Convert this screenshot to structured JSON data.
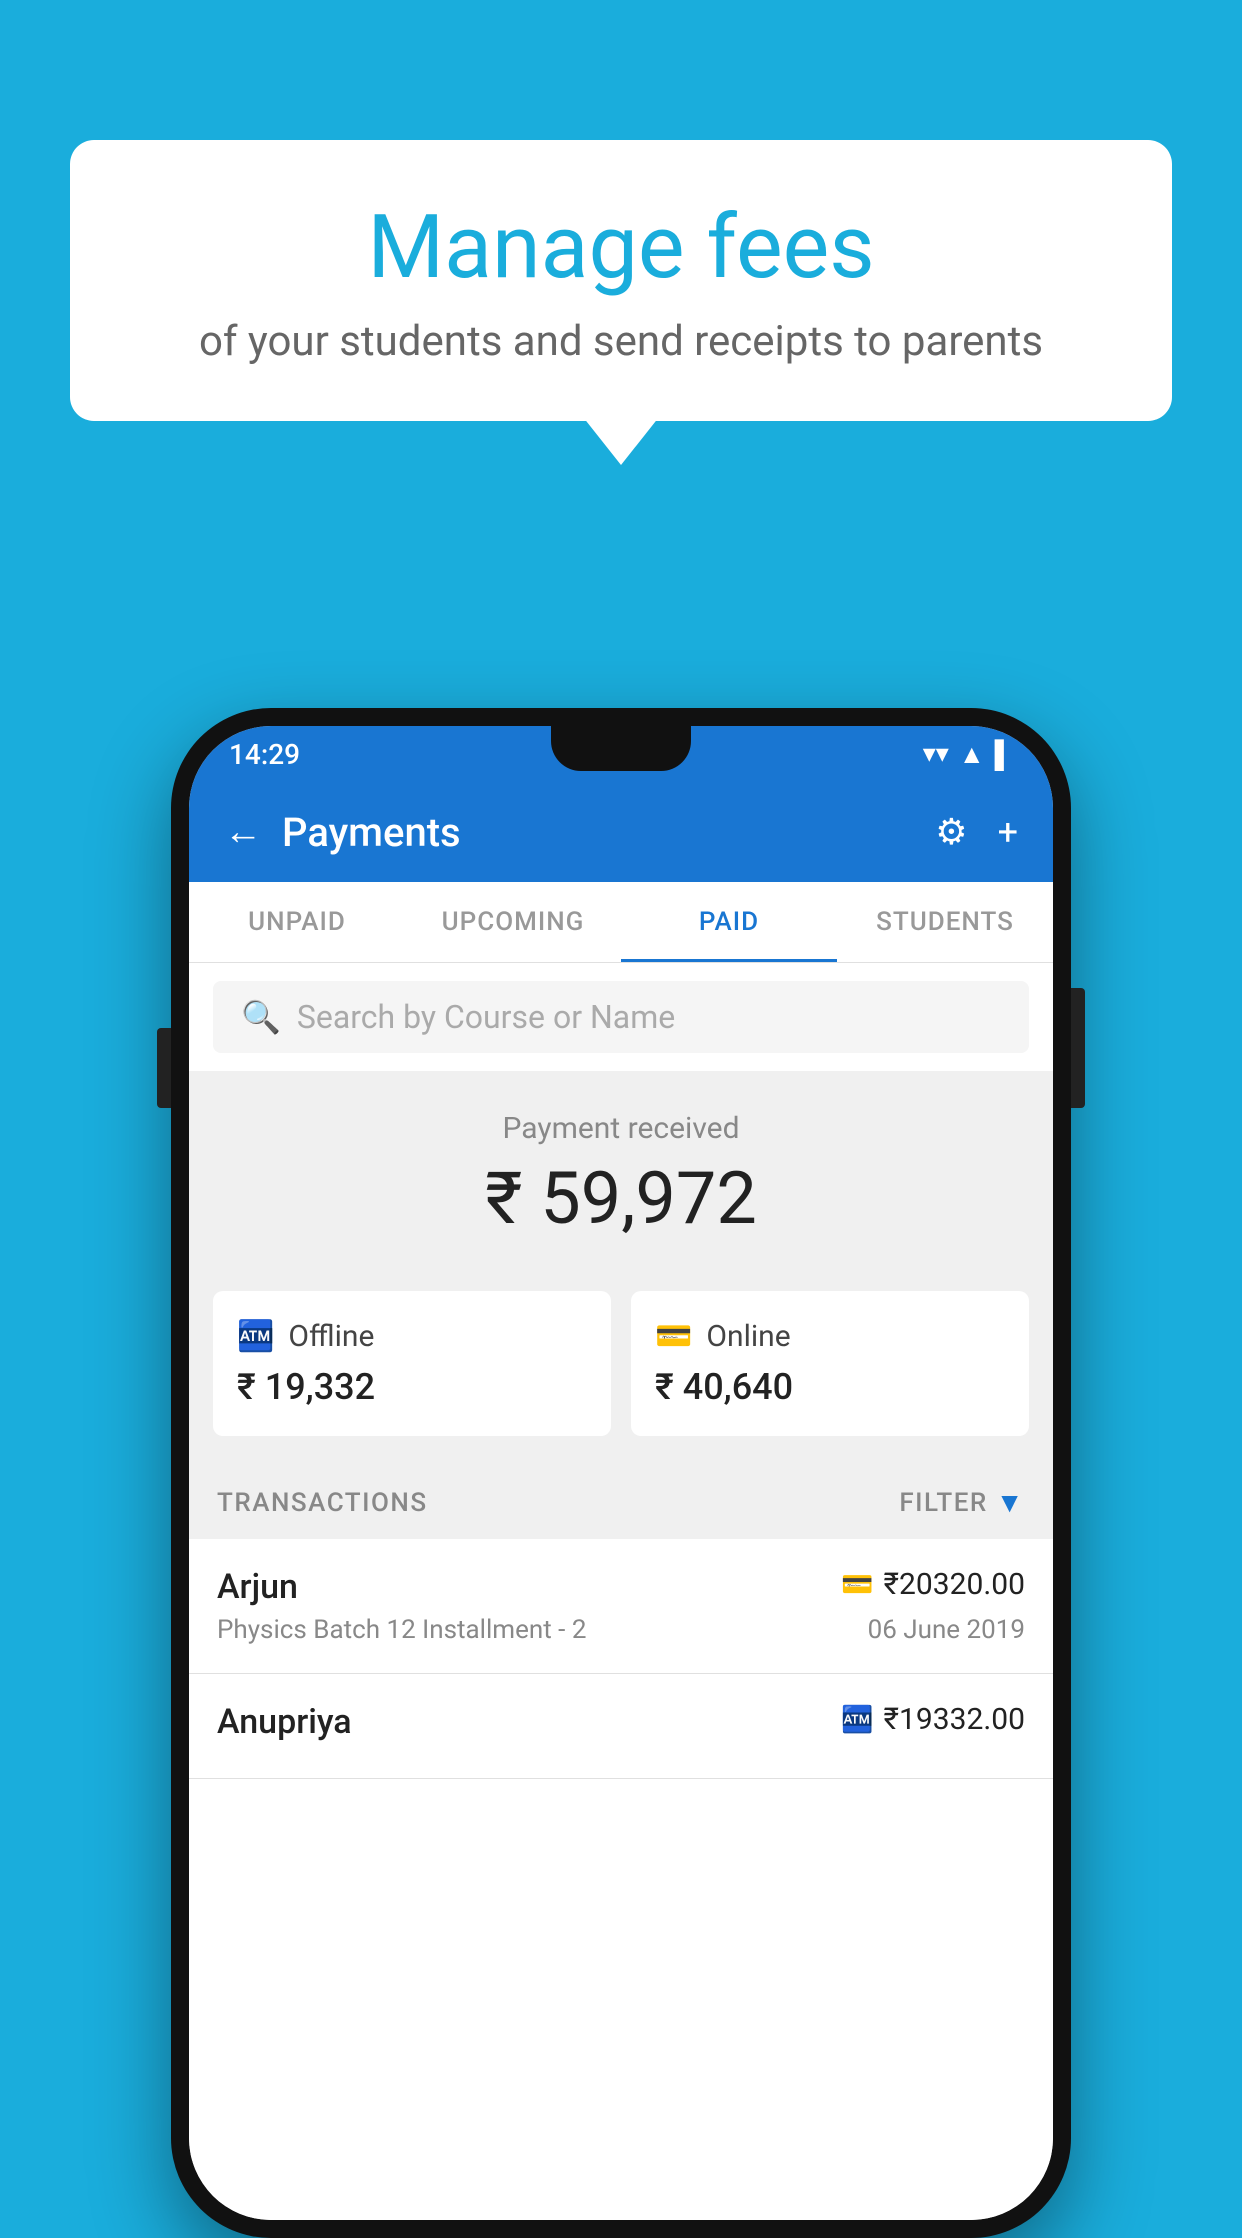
{
  "bubble": {
    "title": "Manage fees",
    "subtitle": "of your students and send receipts to parents"
  },
  "status_bar": {
    "time": "14:29",
    "wifi": "▼",
    "signal": "▲",
    "battery": "▌"
  },
  "header": {
    "title": "Payments",
    "back_icon": "←",
    "settings_icon": "⚙",
    "add_icon": "+"
  },
  "tabs": [
    {
      "id": "unpaid",
      "label": "UNPAID",
      "active": false
    },
    {
      "id": "upcoming",
      "label": "UPCOMING",
      "active": false
    },
    {
      "id": "paid",
      "label": "PAID",
      "active": true
    },
    {
      "id": "students",
      "label": "STUDENTS",
      "active": false
    }
  ],
  "search": {
    "placeholder": "Search by Course or Name"
  },
  "payment_summary": {
    "label": "Payment received",
    "amount": "₹ 59,972"
  },
  "payment_cards": [
    {
      "id": "offline",
      "icon": "offline",
      "label": "Offline",
      "amount": "₹ 19,332"
    },
    {
      "id": "online",
      "icon": "online",
      "label": "Online",
      "amount": "₹ 40,640"
    }
  ],
  "transactions_header": {
    "label": "TRANSACTIONS",
    "filter_label": "FILTER"
  },
  "transactions": [
    {
      "name": "Arjun",
      "course": "Physics Batch 12 Installment - 2",
      "amount": "₹20320.00",
      "date": "06 June 2019",
      "mode": "online"
    },
    {
      "name": "Anupriya",
      "course": "",
      "amount": "₹19332.00",
      "date": "",
      "mode": "offline"
    }
  ],
  "colors": {
    "primary": "#1976D2",
    "accent": "#1AADDC",
    "background": "#f0f0f0",
    "text_dark": "#222222",
    "text_muted": "#888888"
  }
}
